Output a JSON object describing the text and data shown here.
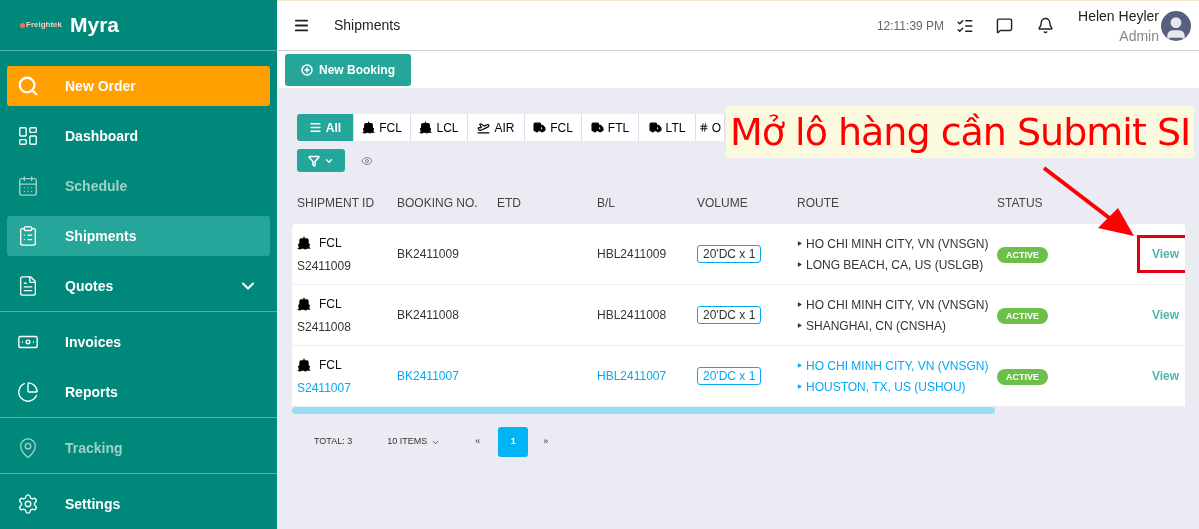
{
  "sidebar": {
    "brand": "Myra",
    "logo_text": "Freightek",
    "groups": [
      {
        "items": [
          {
            "label": "New Order",
            "kind": "action",
            "selected": false,
            "disabled": false
          },
          {
            "label": "Dashboard",
            "kind": "dashboard",
            "selected": false,
            "disabled": false
          },
          {
            "label": "Schedule",
            "kind": "schedule",
            "selected": false,
            "disabled": true
          },
          {
            "label": "Shipments",
            "kind": "shipments",
            "selected": true,
            "disabled": false
          },
          {
            "label": "Quotes",
            "kind": "quotes",
            "selected": false,
            "disabled": false,
            "expandable": true
          }
        ]
      },
      {
        "items": [
          {
            "label": "Invoices",
            "kind": "invoices",
            "selected": false,
            "disabled": false
          },
          {
            "label": "Reports",
            "kind": "reports",
            "selected": false,
            "disabled": false
          }
        ]
      },
      {
        "items": [
          {
            "label": "Tracking",
            "kind": "tracking",
            "selected": false,
            "disabled": true
          }
        ]
      },
      {
        "items": [
          {
            "label": "Settings",
            "kind": "settings",
            "selected": false,
            "disabled": false
          }
        ]
      }
    ]
  },
  "header": {
    "title": "Shipments",
    "time": "12:11:39 PM",
    "user": {
      "name": "Helen Heyler",
      "role": "Admin"
    }
  },
  "toolbar": {
    "new_booking": "New Booking"
  },
  "tabs": [
    {
      "label": "All",
      "kind": "all",
      "selected": true
    },
    {
      "label": "FCL",
      "kind": "sea",
      "selected": false
    },
    {
      "label": "LCL",
      "kind": "sea",
      "selected": false
    },
    {
      "label": "AIR",
      "kind": "air",
      "selected": false
    },
    {
      "label": "FCL",
      "kind": "road",
      "selected": false
    },
    {
      "label": "FTL",
      "kind": "road",
      "selected": false
    },
    {
      "label": "LTL",
      "kind": "road",
      "selected": false
    },
    {
      "label": "O",
      "kind": "other",
      "selected": false
    }
  ],
  "table": {
    "columns": [
      "SHIPMENT ID",
      "BOOKING NO.",
      "ETD",
      "B/L",
      "VOLUME",
      "ROUTE",
      "STATUS"
    ],
    "rows": [
      {
        "mode": "FCL",
        "shipment_id": "S2411009",
        "booking_no": "BK2411009",
        "bl": "HBL2411009",
        "volume": "20'DC x 1",
        "route": [
          "HO CHI MINH CITY, VN (VNSGN)",
          "LONG BEACH, CA, US (USLGB)"
        ],
        "status": "ACTIVE",
        "action": "View",
        "selected": false,
        "boxed": true
      },
      {
        "mode": "FCL",
        "shipment_id": "S2411008",
        "booking_no": "BK2411008",
        "bl": "HBL2411008",
        "volume": "20'DC x 1",
        "route": [
          "HO CHI MINH CITY, VN (VNSGN)",
          "SHANGHAI, CN (CNSHA)"
        ],
        "status": "ACTIVE",
        "action": "View",
        "selected": false,
        "boxed": false
      },
      {
        "mode": "FCL",
        "shipment_id": "S2411007",
        "booking_no": "BK2411007",
        "bl": "HBL2411007",
        "volume": "20'DC x 1",
        "route": [
          "HO CHI MINH CITY, VN (VNSGN)",
          "HOUSTON, TX, US (USHOU)"
        ],
        "status": "ACTIVE",
        "action": "View",
        "selected": true,
        "boxed": false
      }
    ]
  },
  "pagination": {
    "total": "TOTAL: 3",
    "page_size": "10 ITEMS",
    "prev": "«",
    "pages": [
      {
        "label": "1",
        "selected": true
      }
    ],
    "next": "»"
  },
  "annotation": {
    "text": "Mở lô hàng cần Submit SI"
  }
}
